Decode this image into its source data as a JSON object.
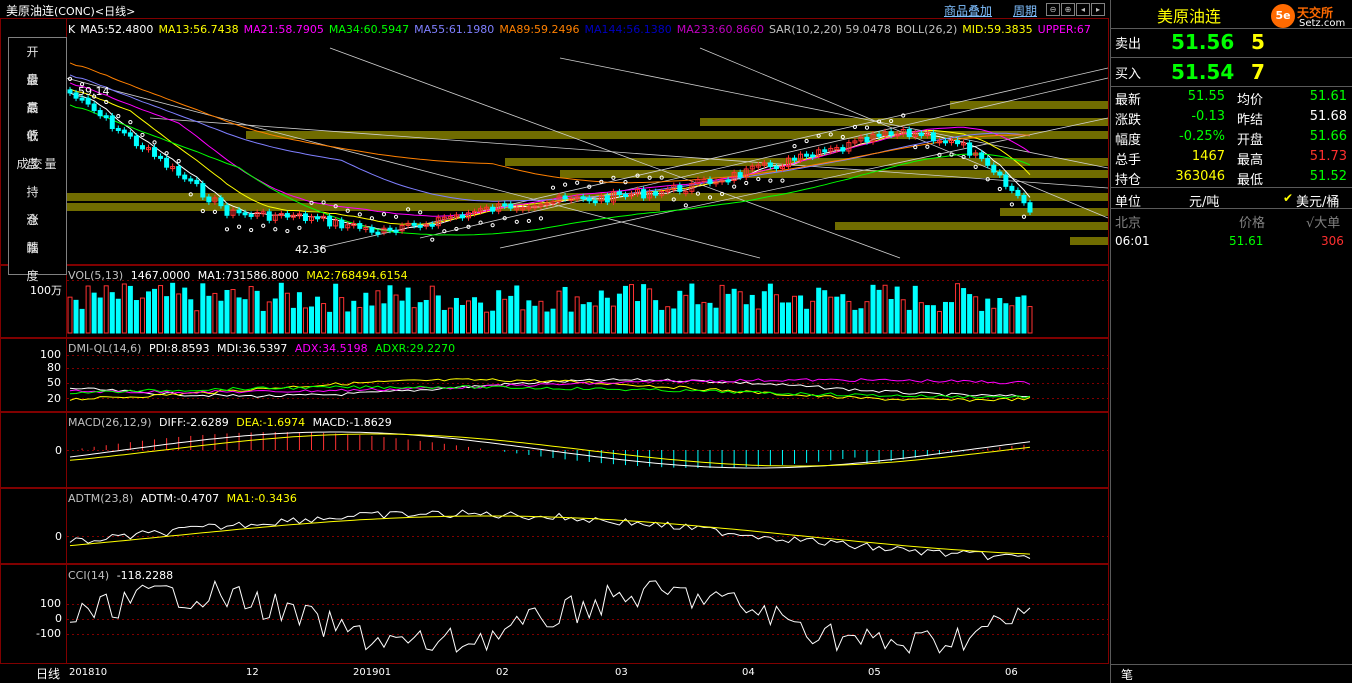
{
  "title": {
    "main": "美原油连",
    "code": "(CONC)",
    "period": "<日线>"
  },
  "toolbar": {
    "overlay": "商品叠加",
    "week": "周期"
  },
  "main_indicators": [
    {
      "t": "K",
      "c": "#ffffff"
    },
    {
      "t": "MA5:52.4800",
      "c": "#ffffff"
    },
    {
      "t": "MA13:56.7438",
      "c": "#ffff00"
    },
    {
      "t": "MA21:58.7905",
      "c": "#ff00ff"
    },
    {
      "t": "MA34:60.5947",
      "c": "#00ff00"
    },
    {
      "t": "MA55:61.1980",
      "c": "#7f7fff"
    },
    {
      "t": "MA89:59.2496",
      "c": "#ff8000"
    },
    {
      "t": "MA144:56.1380",
      "c": "#0000c0"
    },
    {
      "t": "MA233:60.8660",
      "c": "#c000c0"
    },
    {
      "t": "SAR(10,2,20) 59.0478",
      "c": "#c0c0c0"
    },
    {
      "t": "BOLL(26,2)",
      "c": "#c0c0c0"
    },
    {
      "t": "MID:59.3835",
      "c": "#ffff00"
    },
    {
      "t": "UPPER:67",
      "c": "#ff00ff"
    }
  ],
  "left_tool": [
    "开 盘",
    "最 高",
    "最 低",
    "收 盘",
    "成交量",
    "持 仓",
    "涨 跌",
    "幅 度"
  ],
  "price_labels": {
    "high": "59.14",
    "low": "42.36"
  },
  "vol_panel": {
    "header": "VOL(5,13)",
    "v1": "1467.0000",
    "v2": "MA1:731586.8000",
    "v3": "MA2:768494.6154",
    "axis": "100万"
  },
  "dmi_panel": {
    "header": "DMI-QL(14,6)",
    "pdi": "PDI:8.8593",
    "mdi": "MDI:36.5397",
    "adx": "ADX:34.5198",
    "adxr": "ADXR:29.2270",
    "ticks": [
      "100",
      "80",
      "50",
      "20"
    ]
  },
  "macd_panel": {
    "header": "MACD(26,12,9)",
    "diff": "DIFF:-2.6289",
    "dea": "DEA:-1.6974",
    "macd": "MACD:-1.8629",
    "ticks": [
      "0"
    ]
  },
  "adtm_panel": {
    "header": "ADTM(23,8)",
    "adtm": "ADTM:-0.4707",
    "ma1": "MA1:-0.3436",
    "ticks": [
      "0"
    ]
  },
  "cci_panel": {
    "header": "CCI(14)",
    "value": "-118.2288",
    "ticks": [
      "100",
      "0",
      "-100"
    ]
  },
  "x_axis": {
    "period": "日线",
    "labels": [
      "201810",
      "12",
      "201901",
      "02",
      "03",
      "04",
      "05",
      "06"
    ]
  },
  "quote": {
    "name": "美原油连",
    "sell_label": "卖出",
    "sell_price": "51.56",
    "sell_vol": "5",
    "buy_label": "买入",
    "buy_price": "51.54",
    "buy_vol": "7",
    "rows": [
      {
        "l1": "最新",
        "v1": "51.55",
        "c1": "#00ff00",
        "l2": "均价",
        "v2": "51.61",
        "c2": "#00ff00"
      },
      {
        "l1": "涨跌",
        "v1": "-0.13",
        "c1": "#00ff00",
        "l2": "昨结",
        "v2": "51.68",
        "c2": "#ffffff"
      },
      {
        "l1": "幅度",
        "v1": "-0.25%",
        "c1": "#00ff00",
        "l2": "开盘",
        "v2": "51.66",
        "c2": "#00ff00"
      },
      {
        "l1": "总手",
        "v1": "1467",
        "c1": "#ffff00",
        "l2": "最高",
        "v2": "51.73",
        "c2": "#ff3030"
      },
      {
        "l1": "持仓",
        "v1": "363046",
        "c1": "#ffff00",
        "l2": "最低",
        "v2": "51.52",
        "c2": "#00ff00"
      }
    ],
    "unit_label": "单位",
    "unit_value": "元/吨",
    "unit_alt": "美元/桶",
    "tick_header": {
      "a": "北京",
      "b": "价格",
      "c": "√大单"
    },
    "ticks": [
      {
        "time": "06:01",
        "price": "51.61",
        "vol": "306"
      }
    ],
    "bottom_tab": "笔"
  },
  "watermark": {
    "text": "天交所",
    "site": "Setz.com",
    "badge": "5e"
  },
  "colors": {
    "up": "#ff3232",
    "down": "#00ffff",
    "grid": "#800000",
    "accent": "#ffff00"
  }
}
